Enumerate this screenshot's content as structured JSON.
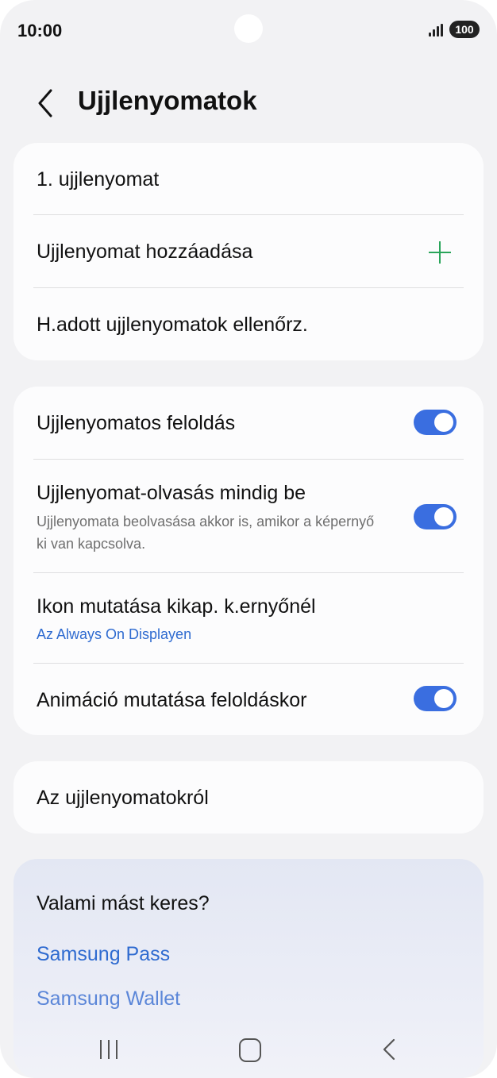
{
  "status": {
    "time": "10:00",
    "battery": "100"
  },
  "header": {
    "title": "Ujjlenyomatok"
  },
  "fingerprints_card": {
    "items": [
      {
        "label": "1. ujjlenyomat"
      },
      {
        "label": "Ujjlenyomat hozzáadása",
        "icon": "plus-icon"
      },
      {
        "label": "H.adott ujjlenyomatok ellenőrz."
      }
    ]
  },
  "settings_card": {
    "items": [
      {
        "label": "Ujjlenyomatos feloldás",
        "toggle": true
      },
      {
        "label": "Ujjlenyomat-olvasás mindig be",
        "sub": "Ujjlenyomata beolvasása akkor is, amikor a képernyő ki van kapcsolva.",
        "toggle": true
      },
      {
        "label": "Ikon mutatása kikap. k.ernyőnél",
        "sub": "Az Always On Displayen"
      },
      {
        "label": "Animáció mutatása feloldáskor",
        "toggle": true
      }
    ]
  },
  "about": {
    "label": "Az ujjlenyomatokról"
  },
  "suggestions": {
    "title": "Valami mást keres?",
    "links": [
      "Samsung Pass",
      "Samsung Wallet"
    ]
  },
  "colors": {
    "accent": "#3a6ee0",
    "link": "#2f6bd0",
    "plus": "#2aa55a",
    "background": "#f2f2f4",
    "card": "#fcfcfd"
  },
  "navbar": {
    "icons": [
      "recent-apps-icon",
      "home-icon",
      "back-icon"
    ]
  }
}
